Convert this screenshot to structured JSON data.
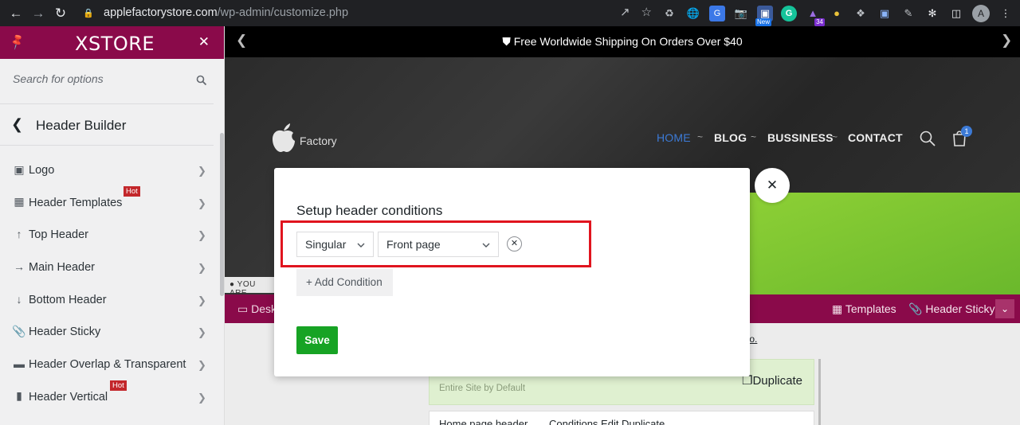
{
  "browser": {
    "url_host": "applefactorystore.com",
    "url_path": "/wp-admin/customize.php",
    "ext_new_badge": "New",
    "ext_count_badge": "34",
    "profile_initial": "A"
  },
  "sidebar": {
    "brand": "XSTORE",
    "search_placeholder": "Search for options",
    "section_title": "Header Builder",
    "items": [
      {
        "label": "Logo",
        "icon": "image-icon",
        "hot": ""
      },
      {
        "label": "Header Templates",
        "icon": "grid-icon",
        "hot": "Hot"
      },
      {
        "label": "Top Header",
        "icon": "arrow-up-icon",
        "hot": ""
      },
      {
        "label": "Main Header",
        "icon": "arrow-right-icon",
        "hot": ""
      },
      {
        "label": "Bottom Header",
        "icon": "arrow-down-icon",
        "hot": ""
      },
      {
        "label": "Header Sticky",
        "icon": "paperclip-icon",
        "hot": ""
      },
      {
        "label": "Header Overlap & Transparent",
        "icon": "layers-icon",
        "hot": ""
      },
      {
        "label": "Header Vertical",
        "icon": "panel-icon",
        "hot": "Hot"
      }
    ]
  },
  "preview": {
    "topbar_text": "Free Worldwide Shipping On Orders Over $40",
    "logo_text": "Factory",
    "nav": [
      "HOME",
      "BLOG",
      "BUSSINESS",
      "CONTACT"
    ],
    "cart_count": "1",
    "you_are": "YOU ARE",
    "admin_left": "Desk",
    "admin_templates": "Templates",
    "admin_sticky": "Header Sticky",
    "video_link": "deo.",
    "panel1_sub": "Entire Site by Default",
    "panel1_dup": "Duplicate",
    "panel2_title": "Home page header",
    "panel2_actions": "Conditions    Edit    Duplicate"
  },
  "modal": {
    "title": "Setup header conditions",
    "select_type": "Singular",
    "select_page": "Front page",
    "remove_symbol": "✕",
    "add_condition": "+ Add Condition",
    "save": "Save",
    "close_symbol": "✕"
  },
  "colors": {
    "brand": "#8a0a4a",
    "save": "#17a324",
    "highlight": "#e0141e",
    "nav_active": "#3c7ad6"
  }
}
